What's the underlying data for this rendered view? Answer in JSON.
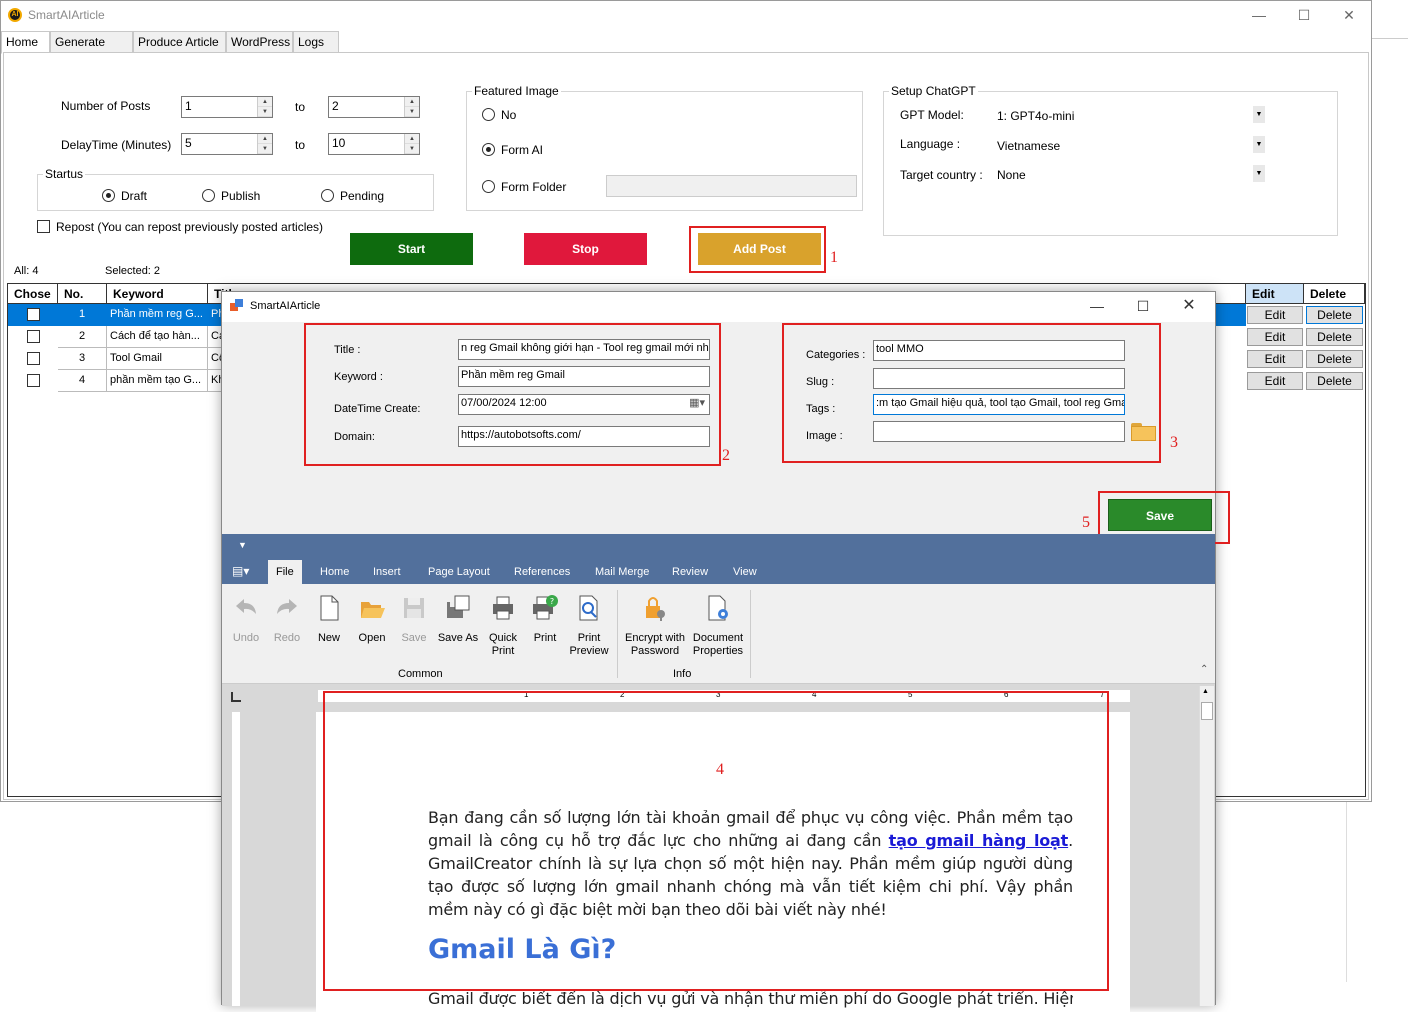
{
  "app": {
    "title": "SmartAIArticle",
    "icon_text": "AI",
    "tabs": [
      "Home",
      "Generate Title",
      "Produce Article",
      "WordPress",
      "Logs"
    ]
  },
  "home": {
    "number_of_posts_label": "Number of Posts",
    "posts_from": "1",
    "posts_to": "2",
    "to_label": "to",
    "delay_label": "DelayTime (Minutes)",
    "delay_from": "5",
    "delay_to": "10",
    "status_group": "Startus",
    "status_options": [
      "Draft",
      "Publish",
      "Pending"
    ],
    "status_selected": "Draft",
    "repost_label": "Repost (You can repost previously posted articles)",
    "featured_group": "Featured Image",
    "featured_options": [
      "No",
      "Form AI",
      "Form Folder"
    ],
    "featured_selected": "Form AI",
    "setup_group": "Setup ChatGPT",
    "gpt_model_label": "GPT Model:",
    "gpt_model_value": "1: GPT4o-mini",
    "language_label": "Language :",
    "language_value": "Vietnamese",
    "target_label": "Target country :",
    "target_value": "None",
    "start_label": "Start",
    "stop_label": "Stop",
    "add_post_label": "Add Post",
    "all_label": "All: 4",
    "selected_label": "Selected: 2",
    "colors": {
      "start": "#0e6b0e",
      "stop": "#e0183c",
      "add_post": "#d9a22c",
      "annotation": "#e02020"
    }
  },
  "grid": {
    "headers": [
      "Chose",
      "No.",
      "Keyword",
      "Title",
      "Edit",
      "Delete"
    ],
    "rows": [
      {
        "no": "1",
        "keyword": "Phần mềm reg G...",
        "title": "Ph",
        "edit": "Edit",
        "delete": "Delete"
      },
      {
        "no": "2",
        "keyword": "Cách để tạo hàn...",
        "title": "Cá",
        "edit": "Edit",
        "delete": "Delete"
      },
      {
        "no": "3",
        "keyword": "Tool Gmail",
        "title": "Cô",
        "edit": "Edit",
        "delete": "Delete"
      },
      {
        "no": "4",
        "keyword": "phần mềm tạo G...",
        "title": "Kh",
        "edit": "Edit",
        "delete": "Delete"
      }
    ]
  },
  "dialog": {
    "title": "SmartAIArticle",
    "title_label": "Title :",
    "title_value": "n reg Gmail không giới hạn - Tool reg gmail mới nhất",
    "keyword_label": "Keyword :",
    "keyword_value": "Phần mềm reg Gmail",
    "datetime_label": "DateTime Create:",
    "datetime_value": "07/00/2024 12:00",
    "domain_label": "Domain:",
    "domain_value": "https://autobotsofts.com/",
    "categories_label": "Categories :",
    "categories_value": "tool MMO",
    "slug_label": "Slug :",
    "slug_value": "",
    "tags_label": "Tags :",
    "tags_value": ":m tạo Gmail hiệu quả, tool tạo Gmail, tool reg Gmail",
    "image_label": "Image :",
    "image_value": "",
    "save_label": "Save",
    "annotations": [
      "1",
      "2",
      "3",
      "4",
      "5"
    ]
  },
  "ribbon": {
    "tabs": [
      "File",
      "Home",
      "Insert",
      "Page Layout",
      "References",
      "Mail Merge",
      "Review",
      "View"
    ],
    "active_tab": "File",
    "buttons": [
      {
        "label": "Undo",
        "icon": "undo-icon"
      },
      {
        "label": "Redo",
        "icon": "redo-icon"
      },
      {
        "label": "New",
        "icon": "new-document-icon"
      },
      {
        "label": "Open",
        "icon": "folder-open-icon"
      },
      {
        "label": "Save",
        "icon": "save-icon"
      },
      {
        "label": "Save As",
        "icon": "save-as-icon"
      },
      {
        "label": "Quick Print",
        "icon": "print-icon"
      },
      {
        "label": "Print",
        "icon": "print-icon"
      },
      {
        "label": "Print Preview",
        "icon": "print-preview-icon"
      },
      {
        "label": "Encrypt with Password",
        "icon": "lock-key-icon"
      },
      {
        "label": "Document Properties",
        "icon": "document-gear-icon"
      }
    ],
    "groups": [
      "Common",
      "Info"
    ]
  },
  "document": {
    "para_part1": "Bạn đang cần số lượng lớn tài khoản gmail để phục vụ công việc. Phần mềm tạo gmail là công cụ hỗ trợ đắc lực cho những ai đang cần ",
    "para_link": "tạo gmail hàng loạt",
    "para_part2": ". GmailCreator chính là sự lựa chọn số một hiện nay. Phần mềm giúp người dùng tạo được số lượng lớn gmail nhanh chóng mà vẫn tiết kiệm chi phí. Vậy phần mềm này có gì đặc biệt mời bạn theo dõi bài viết này nhé!",
    "heading": "Gmail Là Gì?",
    "next_line": "Gmail được biết đến là dịch vụ gửi và nhận thư miễn phí do Google phát triển. Hiện",
    "ruler_numbers": [
      "1",
      "2",
      "3",
      "4",
      "5",
      "6",
      "7"
    ]
  }
}
